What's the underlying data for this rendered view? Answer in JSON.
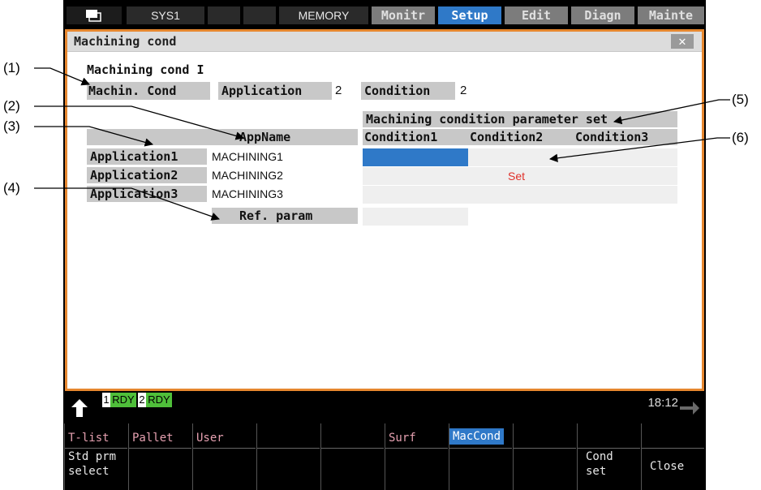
{
  "topbar": {
    "sys": "SYS1",
    "mode": "MEMORY",
    "tabs": [
      "Monitr",
      "Setup",
      "Edit",
      "Diagn",
      "Mainte"
    ],
    "active_tab": "Setup"
  },
  "window": {
    "title": "Machining cond",
    "close": "✕",
    "section_title": "Machining cond I",
    "machin_cond_label": "Machin. Cond",
    "application_label": "Application",
    "application_value": "2",
    "condition_label": "Condition",
    "condition_value": "2",
    "param_set_header": "Machining condition parameter set",
    "appname_header": "AppName",
    "condition_headers": [
      "Condition1",
      "Condition2",
      "Condition3"
    ],
    "rows": [
      {
        "label": "Application1",
        "name": "MACHINING1"
      },
      {
        "label": "Application2",
        "name": "MACHINING2"
      },
      {
        "label": "Application3",
        "name": "MACHINING3"
      }
    ],
    "set_text": "Set",
    "ref_param_label": "Ref. param"
  },
  "status": {
    "rdy1_num": "1",
    "rdy1": "RDY",
    "rdy2_num": "2",
    "rdy2": "RDY",
    "time": "18:12"
  },
  "softkeys": [
    {
      "top": "T-list",
      "bottom": "Std prm\nselect"
    },
    {
      "top": "Pallet",
      "bottom": ""
    },
    {
      "top": "User",
      "bottom": ""
    },
    {
      "top": "",
      "bottom": ""
    },
    {
      "top": "",
      "bottom": ""
    },
    {
      "top": "Surf",
      "bottom": ""
    },
    {
      "top": "MacCond",
      "bottom": "",
      "active": true
    },
    {
      "top": "",
      "bottom": ""
    },
    {
      "top": "",
      "bottom": "Cond\nset"
    },
    {
      "top": "",
      "bottom": "Close"
    }
  ],
  "callouts": [
    "(1)",
    "(2)",
    "(3)",
    "(4)",
    "(5)",
    "(6)"
  ],
  "colors": {
    "accent": "#2f79c8",
    "frame": "#e6872f",
    "set_text": "#e0302a",
    "rdy_green": "#4fbf3a"
  }
}
